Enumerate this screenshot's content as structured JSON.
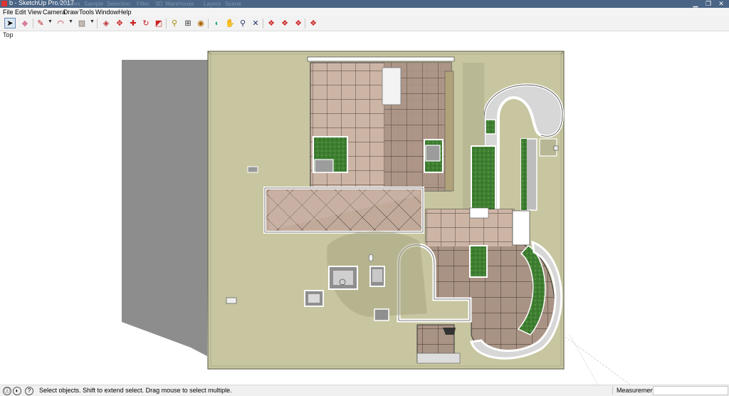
{
  "window": {
    "title": "b - SketchUp Pro 2017",
    "ghost_menu": [
      "Windows",
      "Sample",
      "Selection",
      "Filter",
      "3D",
      "Warehouse",
      "Layers",
      "Scene"
    ]
  },
  "menu": [
    "File",
    "Edit",
    "View",
    "Camera",
    "Draw",
    "Tools",
    "Window",
    "Help"
  ],
  "toolbar": {
    "tools": [
      "select-tool",
      "eraser-tool",
      "line-tool",
      "arc-tool",
      "shape-tool",
      "push-pull-tool",
      "move-tool",
      "rotate-tool",
      "scale-tool",
      "offset-tool",
      "tape-measure-tool",
      "dimension-tool",
      "paint-bucket-tool",
      "orbit-tool",
      "pan-tool",
      "zoom-tool",
      "zoom-extents-tool",
      "3d-warehouse-tool",
      "extension-warehouse-tool",
      "layout-tool",
      "extension-manager-tool"
    ]
  },
  "viewport": {
    "scene": "Top"
  },
  "status": {
    "hint": "Select objects. Shift to extend select. Drag mouse to select multiple.",
    "measurements_label": "Measurements",
    "measurements_value": ""
  },
  "colors": {
    "titlebar": "#4a6585",
    "ground": "#c7c6a0",
    "tile_light": "#cdb5a6",
    "tile_dark": "#a99384",
    "grass": "#3f7f32",
    "shadow": "#8a8a8a"
  }
}
